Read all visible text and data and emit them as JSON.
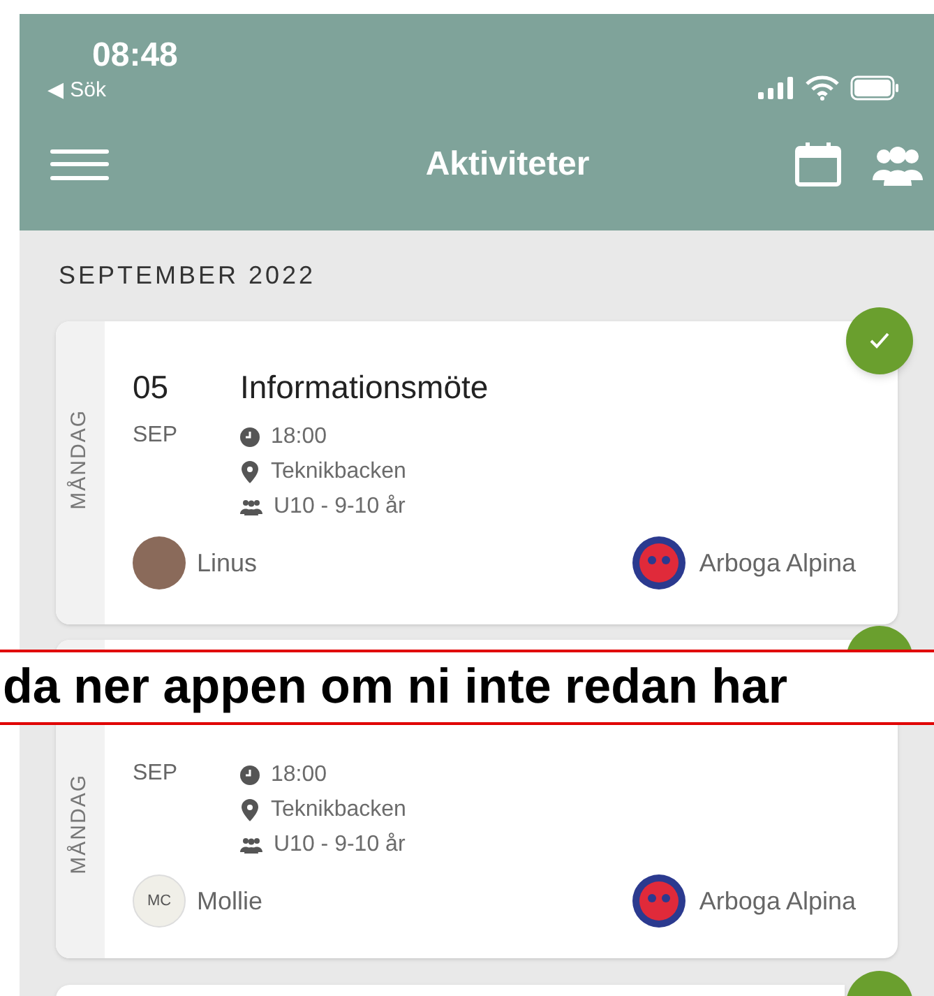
{
  "status_bar": {
    "time": "08:48",
    "back_link": "◀ Sök"
  },
  "nav_bar": {
    "title": "Aktiviteter"
  },
  "month_heading": "SEPTEMBER 2022",
  "cards": [
    {
      "weekday": "MÅNDAG",
      "day": "05",
      "month": "SEP",
      "title": "Informationsmöte",
      "time": "18:00",
      "place": "Teknikbacken",
      "group": "U10 - 9-10 år",
      "leader": {
        "kind": "photo",
        "name": "Linus"
      },
      "club": "Arboga Alpina",
      "checked": true
    },
    {
      "weekday": "MÅNDAG",
      "month": "SEP",
      "time": "18:00",
      "place": "Teknikbacken",
      "group": "U10 - 9-10 år",
      "leader": {
        "kind": "initials",
        "initials": "MC",
        "name": "Mollie"
      },
      "club": "Arboga Alpina",
      "checked": true
    },
    {
      "checked": true
    }
  ],
  "banner": {
    "text": "da ner appen om ni inte redan har"
  }
}
